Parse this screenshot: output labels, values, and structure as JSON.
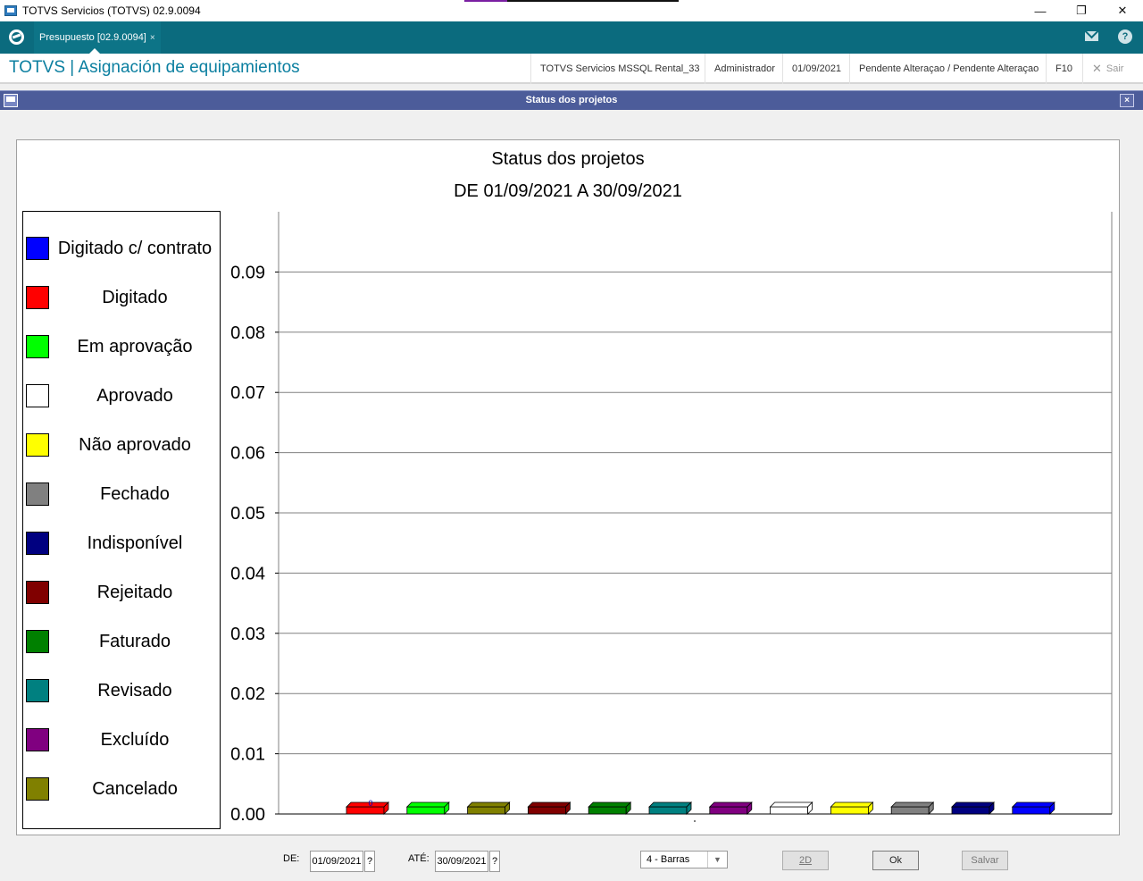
{
  "window": {
    "title": "TOTVS Servicios (TOTVS) 02.9.0094",
    "min": "—",
    "restore": "❐",
    "close": "✕"
  },
  "tabbar": {
    "tab_label": "Presupuesto [02.9.0094]",
    "tab_close": "×",
    "help": "?"
  },
  "header": {
    "title": "TOTVS | Asignación de equipamientos",
    "environment": "TOTVS Servicios MSSQL Rental_33",
    "user": "Administrador",
    "date": "01/09/2021",
    "status": "Pendente Alteraçao / Pendente Alteraçao",
    "shortcut": "F10",
    "exit_label": "Sair"
  },
  "dialog": {
    "title": "Status dos projetos",
    "close": "×"
  },
  "colors": {
    "accent": "#0b6b7e",
    "title_blue": "#0b7fa0",
    "dialog_bar": "#4c5c9a"
  },
  "chart_data": {
    "type": "bar",
    "title": "Status dos projetos",
    "subtitle": "DE 01/09/2021 A 30/09/2021",
    "ylim": [
      0,
      0.1
    ],
    "yticks": [
      "0.00",
      "0.01",
      "0.02",
      "0.03",
      "0.04",
      "0.05",
      "0.06",
      "0.07",
      "0.08",
      "0.09"
    ],
    "grid": true,
    "legend_position": "left",
    "legend": [
      {
        "name": "Digitado c/ contrato",
        "color": "#0000ff"
      },
      {
        "name": "Digitado",
        "color": "#ff0000"
      },
      {
        "name": "Em aprovação",
        "color": "#00ff00"
      },
      {
        "name": "Aprovado",
        "color": "#ffffff"
      },
      {
        "name": "Não aprovado",
        "color": "#ffff00"
      },
      {
        "name": "Fechado",
        "color": "#808080"
      },
      {
        "name": "Indisponível",
        "color": "#000080"
      },
      {
        "name": "Rejeitado",
        "color": "#800000"
      },
      {
        "name": "Faturado",
        "color": "#008000"
      },
      {
        "name": "Revisado",
        "color": "#008080"
      },
      {
        "name": "Excluído",
        "color": "#800080"
      },
      {
        "name": "Cancelado",
        "color": "#808000"
      }
    ],
    "bars": [
      {
        "color": "#ff0000",
        "value": 0,
        "label": "0"
      },
      {
        "color": "#00ff00",
        "value": 0
      },
      {
        "color": "#808000",
        "value": 0
      },
      {
        "color": "#800000",
        "value": 0
      },
      {
        "color": "#008000",
        "value": 0
      },
      {
        "color": "#008080",
        "value": 0
      },
      {
        "color": "#800080",
        "value": 0
      },
      {
        "color": "#ffffff",
        "value": 0
      },
      {
        "color": "#ffff00",
        "value": 0
      },
      {
        "color": "#808080",
        "value": 0
      },
      {
        "color": "#000080",
        "value": 0
      },
      {
        "color": "#0000ff",
        "value": 0
      }
    ]
  },
  "controls": {
    "from_label": "DE:",
    "from_value": "01/09/2021",
    "from_lookup": "?",
    "to_label": "ATÉ:",
    "to_value": "30/09/2021",
    "to_lookup": "?",
    "chart_type_value": "4 - Barras",
    "btn_2d": "2D",
    "btn_ok": "Ok",
    "btn_save": "Salvar"
  }
}
